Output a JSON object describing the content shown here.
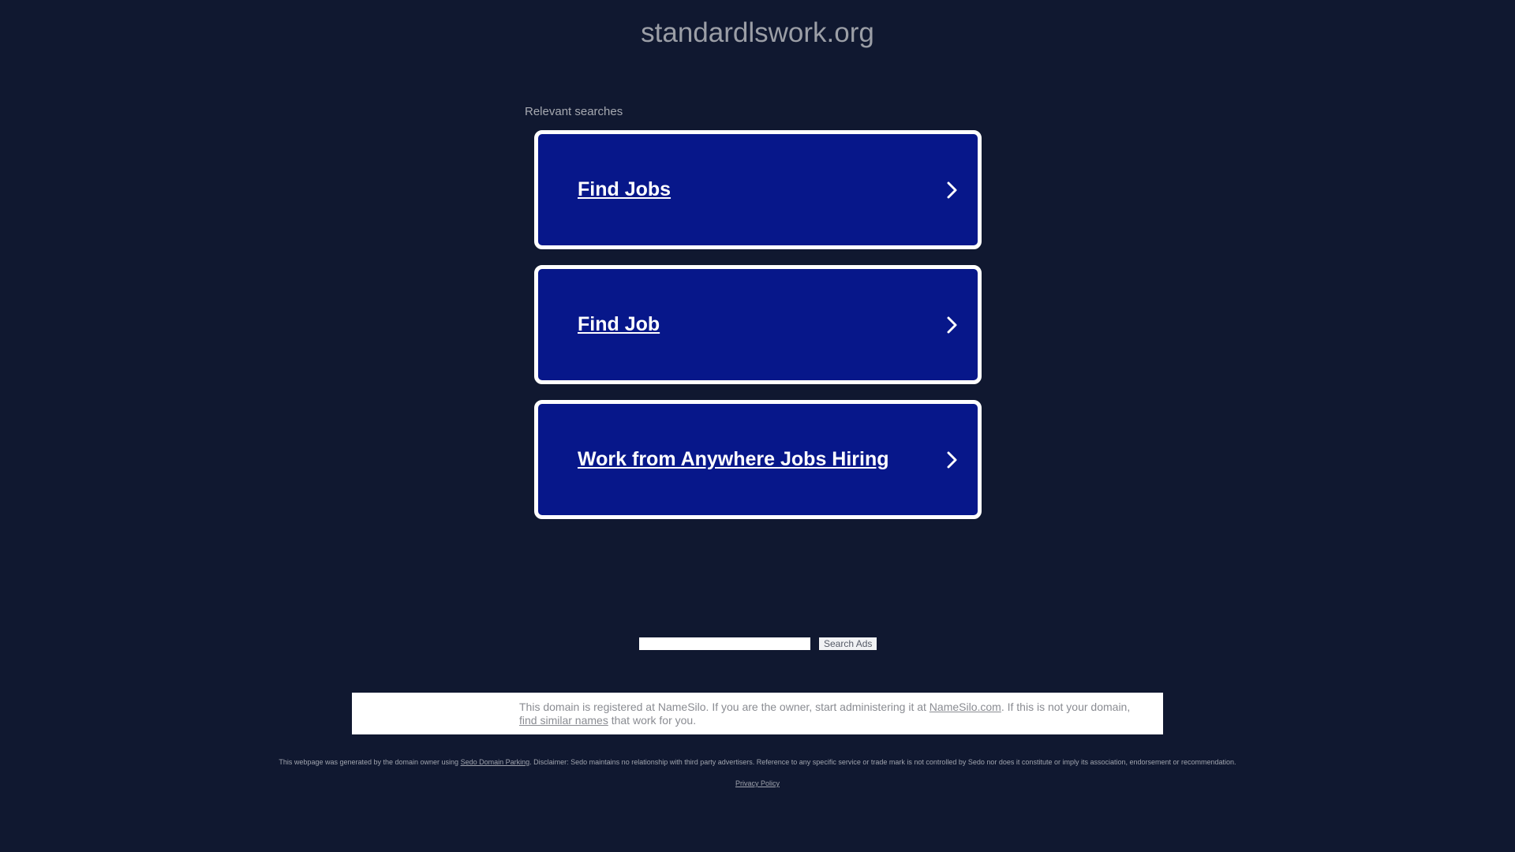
{
  "header": {
    "domain": "standardlswork.org"
  },
  "relevant": {
    "label": "Relevant searches",
    "items": [
      {
        "label": "Find Jobs"
      },
      {
        "label": "Find Job"
      },
      {
        "label": "Work from Anywhere Jobs Hiring"
      }
    ]
  },
  "search": {
    "input_value": "",
    "button_label": "Search Ads"
  },
  "registrar": {
    "text_before": "This domain is registered at NameSilo. If you are the owner, start administering it at ",
    "link_namesilo": "NameSilo.com",
    "text_middle": ". If this is not your domain, ",
    "link_similar": "find similar names",
    "text_after": " that work for you."
  },
  "footer": {
    "disclaimer_before": "This webpage was generated by the domain owner using ",
    "disclaimer_link": "Sedo Domain Parking",
    "disclaimer_after": ". Disclaimer: Sedo maintains no relationship with third party advertisers. Reference to any specific service or trade mark is not controlled by Sedo nor does it constitute or imply its association, endorsement or recommendation.",
    "privacy_label": "Privacy Policy"
  },
  "colors": {
    "background": "#101830",
    "card": "#07178a",
    "card_border": "#ffffff"
  },
  "icons": {
    "card_arrow": "chevron-right-icon"
  }
}
